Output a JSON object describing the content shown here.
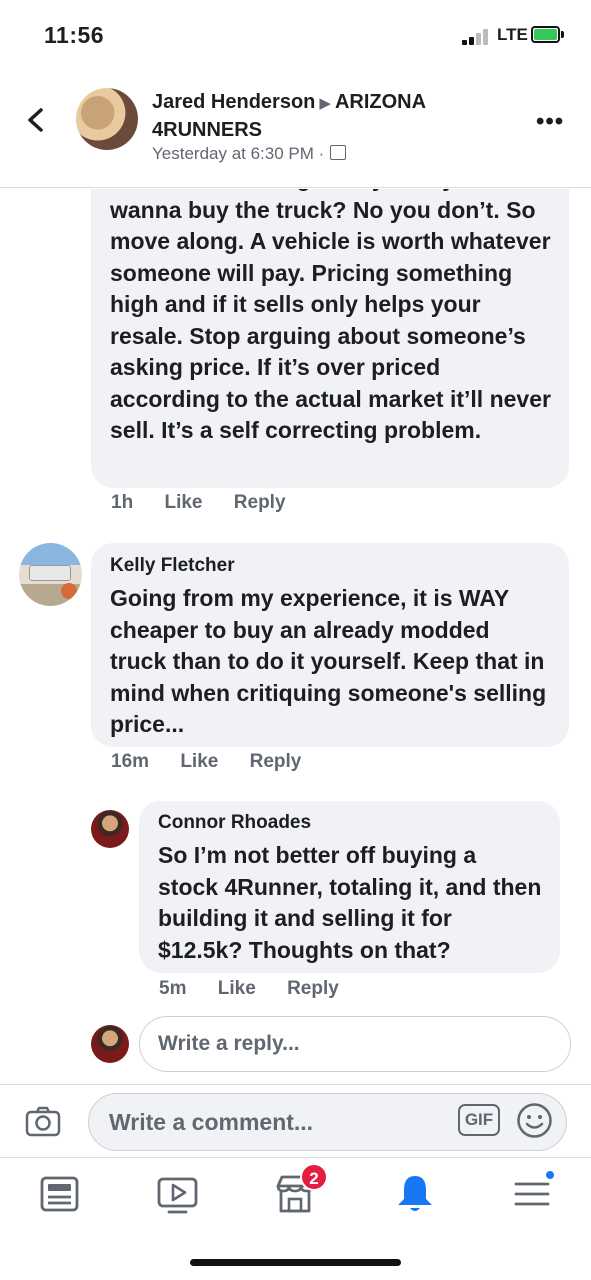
{
  "status_bar": {
    "time": "11:56",
    "network": "LTE"
  },
  "header": {
    "author": "Jared Henderson",
    "group": "ARIZONA 4RUNNERS",
    "timestamp": "Yesterday at 6:30 PM ·"
  },
  "comments": [
    {
      "text": "ridiculous of things. Why? Do you wanna buy the truck? No you don’t. So move along. A vehicle is worth whatever someone will pay. Pricing something high and if it sells only helps your resale. Stop arguing about someone’s asking price. If it’s over priced according to the actual market it’ll never sell. It’s a self correcting problem.",
      "time": "1h",
      "like": "Like",
      "reply": "Reply"
    },
    {
      "author": "Kelly Fletcher",
      "text": "Going from my experience, it is WAY cheaper to buy an already modded truck than to do it yourself.  Keep that in mind when critiquing someone's selling price...",
      "time": "16m",
      "like": "Like",
      "reply": "Reply"
    },
    {
      "author": "Connor Rhoades",
      "text": "So I’m not better off buying a stock 4Runner, totaling it, and then building it and selling it for $12.5k? Thoughts on that?",
      "time": "5m",
      "like": "Like",
      "reply": "Reply"
    }
  ],
  "reply_box": {
    "placeholder": "Write a reply..."
  },
  "composer": {
    "placeholder": "Write a comment...",
    "gif_label": "GIF"
  },
  "nav": {
    "items": [
      "news-feed-icon",
      "watch-icon",
      "marketplace-icon",
      "notifications-icon",
      "menu-icon"
    ],
    "marketplace_badge": "2"
  },
  "colors": {
    "accent": "#1877f2",
    "badge": "#e41e3f",
    "bubble": "#f0f2f5",
    "secondary_text": "#606770"
  }
}
